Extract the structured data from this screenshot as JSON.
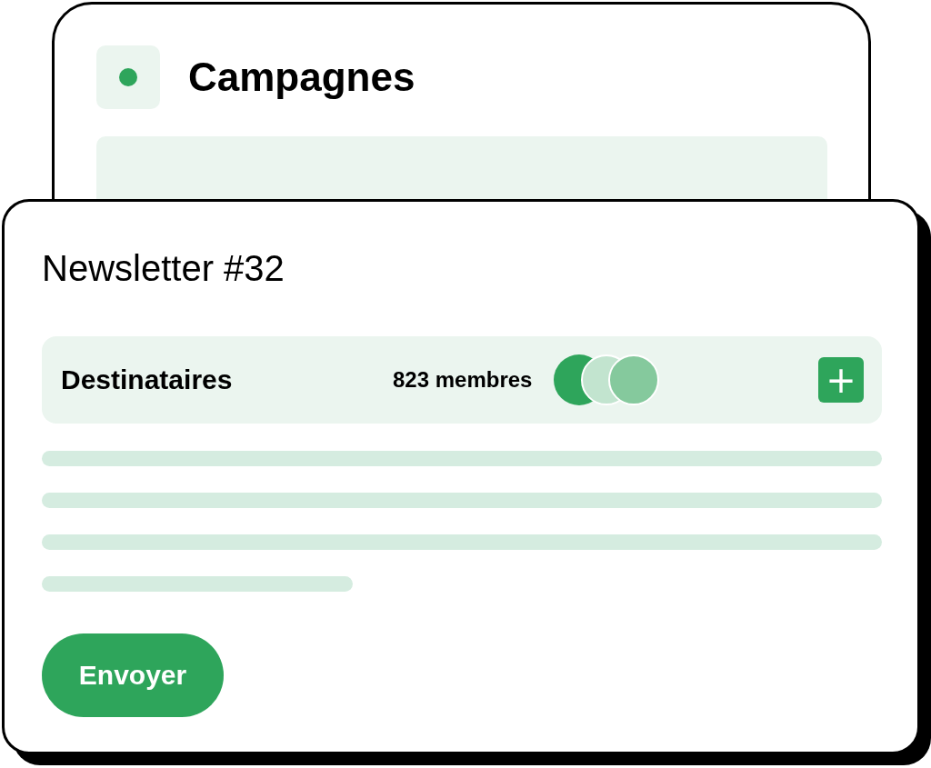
{
  "back_window": {
    "title": "Campagnes"
  },
  "card": {
    "title": "Newsletter #32",
    "recipients": {
      "label": "Destinataires",
      "count": "823 membres",
      "avatars": [
        {
          "color": "#2ea55b"
        },
        {
          "color": "#c2e4cf"
        },
        {
          "color": "#85c99d"
        }
      ],
      "add_button": "+"
    },
    "send_button": "Envoyer"
  }
}
